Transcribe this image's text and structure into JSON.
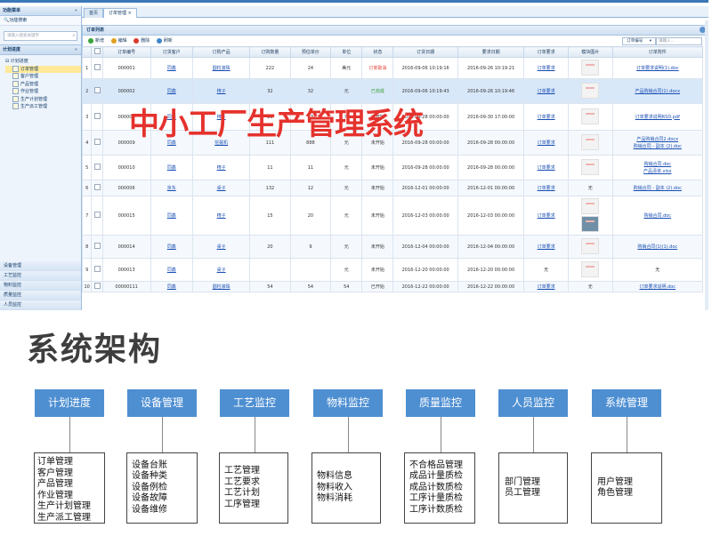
{
  "sidebar": {
    "header": "功能菜单",
    "search_row": "功能搜索",
    "search_placeholder": "请输入搜索关键字",
    "section": "计划进度",
    "tree_root": "计划进度",
    "tree_items": [
      "订单管理",
      "客户管理",
      "产品管理",
      "作业管理",
      "生产计划管理",
      "生产派工管理"
    ],
    "bottom_items": [
      "设备管理",
      "工艺监控",
      "物料监控",
      "质量监控",
      "人员监控"
    ]
  },
  "tabs": [
    "首页",
    "订单管理"
  ],
  "panel_title": "订单列表",
  "toolbar": {
    "add": "新增",
    "edit": "编辑",
    "delete": "删除",
    "refresh": "刷新",
    "filter_select": "订单编号",
    "filter_placeholder": "请输入..."
  },
  "columns": [
    "",
    "",
    "订单编号",
    "订货客户",
    "订购产品",
    "订购数量",
    "预估单价",
    "单位",
    "状态",
    "订货日期",
    "要求日期",
    "订单要求",
    "模块图片",
    "订单附件"
  ],
  "rows": [
    {
      "n": "1",
      "id": "000001",
      "cust": "同鑫",
      "prod": "圆柱滚珠",
      "qty": "222",
      "price": "24",
      "unit": "美元",
      "status": "订单取消",
      "status_color": "red",
      "order_date": "2016-09-06 10:19:16",
      "req_date": "2016-09-26 10:19:21",
      "req": "订单要求",
      "img": "thumb",
      "att": [
        "订单要求说明(1).doc"
      ]
    },
    {
      "n": "2",
      "id": "000002",
      "cust": "同鑫",
      "prod": "椅子",
      "qty": "32",
      "price": "32",
      "unit": "元",
      "status": "已完成",
      "status_color": "green",
      "order_date": "2016-09-06 10:19:43",
      "req_date": "2016-09-26 10:19:46",
      "req": "订单要求",
      "img": "thumb",
      "att": [
        "产品购销合同(1).docx"
      ]
    },
    {
      "n": "3",
      "id": "000003",
      "cust": "同鑫",
      "prod": "椅子",
      "qty": "23",
      "price": "23",
      "unit": "元",
      "status": "未开始",
      "status_color": "",
      "order_date": "2016-09-28 00:00:00",
      "req_date": "2016-09-30 17:00:00",
      "req": "订单要求",
      "img": "thumb",
      "att": [
        "订单要求说明RSD.pdf"
      ]
    },
    {
      "n": "4",
      "id": "000009",
      "cust": "同鑫",
      "prod": "挖掘机",
      "qty": "111",
      "price": "888",
      "unit": "元",
      "status": "未开始",
      "status_color": "",
      "order_date": "2016-09-28 00:00:00",
      "req_date": "2016-09-28 00:00:00",
      "req": "订单要求",
      "img": "thumb",
      "att": [
        "产品购销合同2.docx",
        "购销合同 - 副本 (2).doc"
      ]
    },
    {
      "n": "5",
      "id": "000010",
      "cust": "同鑫",
      "prod": "椅子",
      "qty": "11",
      "price": "11",
      "unit": "元",
      "status": "未开始",
      "status_color": "",
      "order_date": "2016-09-28 00:00:00",
      "req_date": "2016-09-28 00:00:00",
      "req": "订单要求",
      "img": "thumb",
      "att": [
        "购销合同.doc",
        "产品清单.xlsx"
      ]
    },
    {
      "n": "6",
      "id": "000006",
      "cust": "京东",
      "prod": "桌子",
      "qty": "132",
      "price": "12",
      "unit": "元",
      "status": "未开始",
      "status_color": "",
      "order_date": "2016-12-01 00:00:00",
      "req_date": "2016-12-01 00:00:00",
      "req": "订单要求",
      "img": "无",
      "att": [
        "购销合同 - 副本 (2).doc"
      ]
    },
    {
      "n": "7",
      "id": "000015",
      "cust": "同鑫",
      "prod": "椅子",
      "qty": "15",
      "price": "20",
      "unit": "元",
      "status": "未开始",
      "status_color": "",
      "order_date": "2016-12-03 00:00:00",
      "req_date": "2016-12-03 00:00:00",
      "req": "订单要求",
      "img": "thumb2",
      "att": [
        "购销合同.doc"
      ]
    },
    {
      "n": "8",
      "id": "000014",
      "cust": "同鑫",
      "prod": "桌子",
      "qty": "20",
      "price": "9",
      "unit": "元",
      "status": "未开始",
      "status_color": "",
      "order_date": "2016-12-04 00:00:00",
      "req_date": "2016-12-04 00:00:00",
      "req": "订单要求",
      "img": "thumb",
      "att": [
        "购销合同(1)(1).doc"
      ]
    },
    {
      "n": "9",
      "id": "000013",
      "cust": "同鑫",
      "prod": "桌子",
      "qty": "",
      "price": "",
      "unit": "元",
      "status": "未开始",
      "status_color": "",
      "order_date": "2016-12-20 00:00:00",
      "req_date": "2016-12-20 00:00:00",
      "req": "无",
      "img": "thumb",
      "att": [
        "无"
      ]
    },
    {
      "n": "10",
      "id": "00000111",
      "cust": "同鑫",
      "prod": "圆柱滚珠",
      "qty": "54",
      "price": "54",
      "unit": "54",
      "status": "已开始",
      "status_color": "",
      "order_date": "2016-12-22 00:00:00",
      "req_date": "2016-12-22 00:00:00",
      "req": "订单要求",
      "img": "无",
      "att": [
        "订单要求说明.doc"
      ]
    }
  ],
  "overlay_title": "中小工厂生产管理系统",
  "arch_title": "系统架构",
  "modules": [
    {
      "title": "计划进度",
      "items": [
        "订单管理",
        "客户管理",
        "产品管理",
        "作业管理",
        "生产计划管理",
        "生产派工管理"
      ]
    },
    {
      "title": "设备管理",
      "items": [
        "设备台账",
        "设备种类",
        "设备例检",
        "设备故障",
        "设备维修"
      ]
    },
    {
      "title": "工艺监控",
      "items": [
        "工艺管理",
        "工艺要求",
        "工艺计划",
        "工序管理"
      ]
    },
    {
      "title": "物料监控",
      "items": [
        "物料信息",
        "物料收入",
        "物料消耗"
      ]
    },
    {
      "title": "质量监控",
      "items": [
        "不合格品管理",
        "成品计量质检",
        "成品计数质检",
        "工序计量质检",
        "工序计数质检"
      ]
    },
    {
      "title": "人员监控",
      "items": [
        "部门管理",
        "员工管理"
      ]
    },
    {
      "title": "系统管理",
      "items": [
        "用户管理",
        "角色管理"
      ]
    }
  ],
  "colors": {
    "accent": "#4e8fd2",
    "overlay": "#e5322d",
    "link": "#1a4fb3"
  }
}
